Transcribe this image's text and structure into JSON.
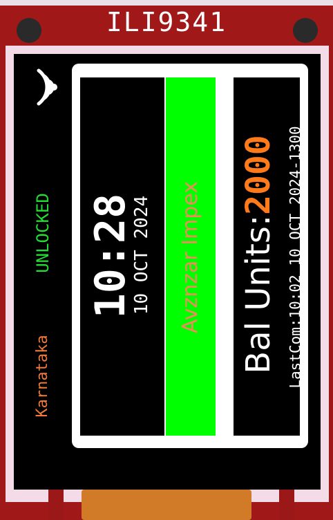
{
  "board": {
    "title": "ILI9341",
    "color": "#a01818"
  },
  "status": {
    "lock_state": "UNLOCKED",
    "lock_color": "#22dd33",
    "region": "Karnataka",
    "region_color": "#ef7a3a",
    "icon": "wifi-icon"
  },
  "clock": {
    "time": "10:28",
    "date": "10 OCT 2024"
  },
  "company": {
    "name": "Avznzar Impex",
    "text_color": "#ef8a5a",
    "bg_color": "#00ff00"
  },
  "balance": {
    "label": "Bal Units:",
    "value": "2000",
    "value_color": "#ff7a1a",
    "last_comm": "LastCom:10:02 10 OCT 2024-1300"
  }
}
